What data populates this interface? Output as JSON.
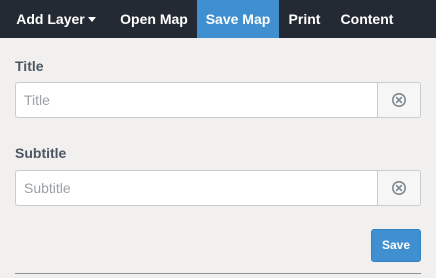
{
  "nav": {
    "add_layer": "Add Layer",
    "open_map": "Open Map",
    "save_map": "Save Map",
    "print": "Print",
    "content": "Content"
  },
  "form": {
    "title_label": "Title",
    "title_placeholder": "Title",
    "title_value": "",
    "subtitle_label": "Subtitle",
    "subtitle_placeholder": "Subtitle",
    "subtitle_value": "",
    "save_label": "Save"
  },
  "icons": {
    "clear": "close-circle-icon",
    "dropdown": "caret-down-icon"
  },
  "colors": {
    "nav_background": "#232a33",
    "active_tab": "#3f8fd1",
    "button_primary": "#3f8fd1",
    "page_background": "#f1f0ee"
  }
}
